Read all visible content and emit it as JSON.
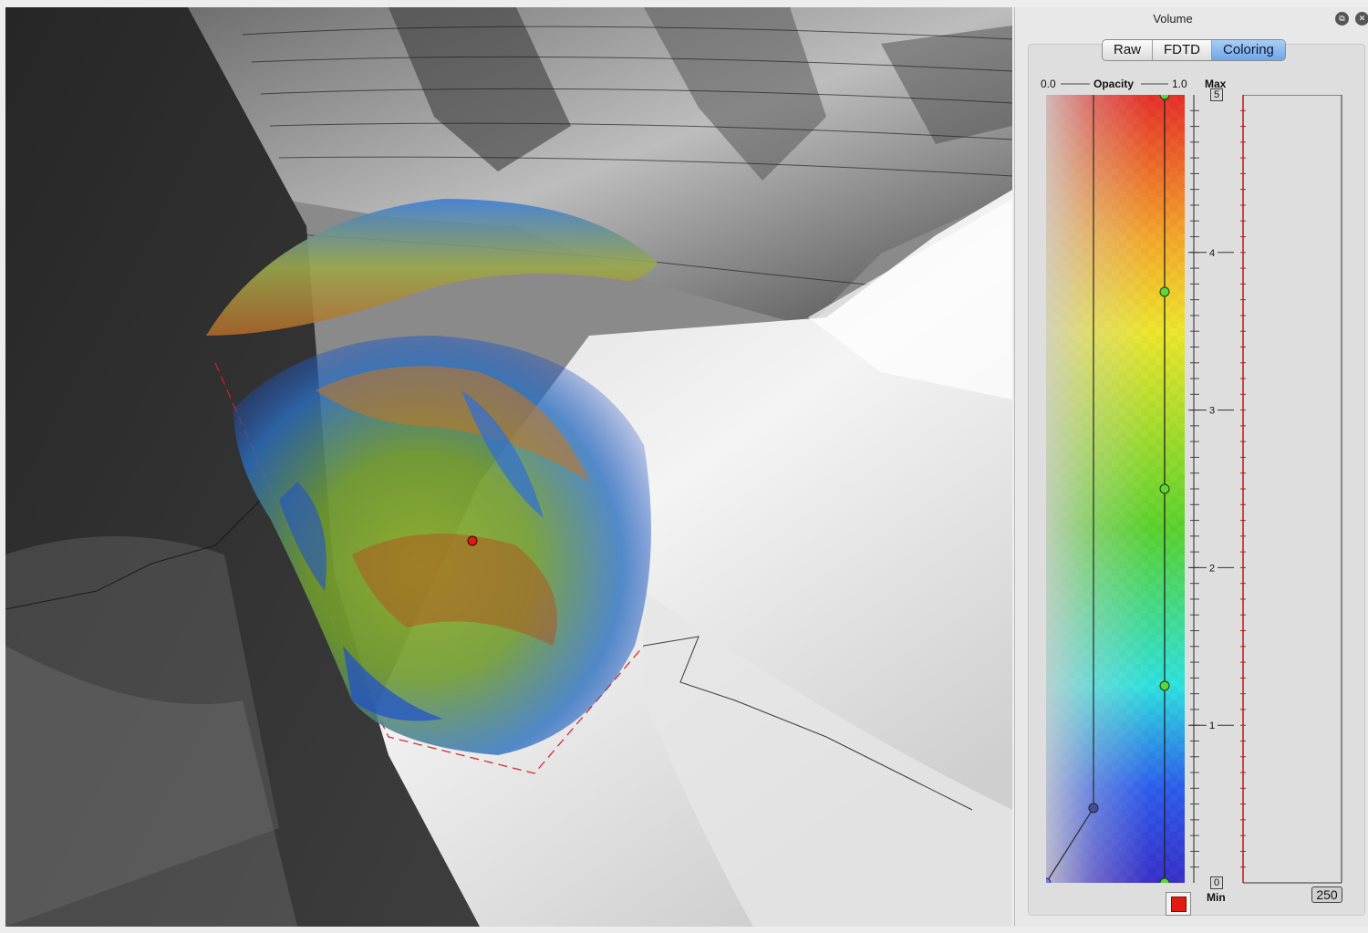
{
  "panel": {
    "title": "Volume",
    "float_icon": "float-window-icon",
    "close_icon": "close-icon"
  },
  "tabs": [
    {
      "label": "Raw",
      "active": false
    },
    {
      "label": "FDTD",
      "active": false
    },
    {
      "label": "Coloring",
      "active": true
    }
  ],
  "transfer_function": {
    "opacity_min_label": "0.0",
    "opacity_label": "Opacity",
    "opacity_max_label": "1.0",
    "max_label": "Max",
    "min_label": "Min",
    "max_value": "5",
    "min_value": "0",
    "count_value": "250",
    "scale_ticks": [
      "4",
      "3",
      "2",
      "1"
    ],
    "selected_color": "#e21b12",
    "color_stops": [
      "#e8201a",
      "#f7a21b",
      "#f0e81c",
      "#4fd21e",
      "#1fe3e0",
      "#1e52f0",
      "#2a21c8"
    ]
  },
  "viewport": {
    "description_icon": "3d-terrain-volume-render"
  }
}
